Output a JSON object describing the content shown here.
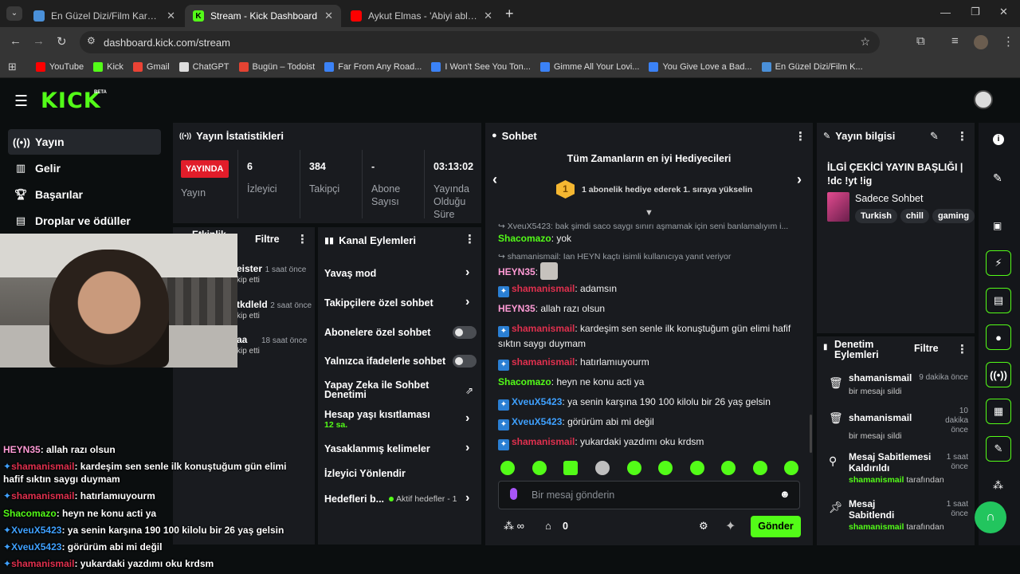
{
  "browser": {
    "tabs": [
      {
        "title": "En Güzel Dizi/Film Karakteri - T",
        "favicon_color": "#4a90d9"
      },
      {
        "title": "Stream - Kick Dashboard",
        "favicon_color": "#53fc18",
        "favicon_glyph": "K"
      },
      {
        "title": "Aykut Elmas - 'Abiyi ablayı' Lug",
        "favicon_color": "#ff0000"
      }
    ],
    "new_tab_label": "+",
    "url": "dashboard.kick.com/stream",
    "bookmarks": [
      {
        "label": "YouTube",
        "color": "#ff0000"
      },
      {
        "label": "Kick",
        "color": "#53fc18"
      },
      {
        "label": "Gmail",
        "color": "#ea4335"
      },
      {
        "label": "ChatGPT",
        "color": "#dddddd"
      },
      {
        "label": "Bugün – Todoist",
        "color": "#e44332"
      },
      {
        "label": "Far From Any Road...",
        "color": "#3b82f6"
      },
      {
        "label": "I Won't See You Ton...",
        "color": "#3b82f6"
      },
      {
        "label": "Gimme All Your Lovi...",
        "color": "#3b82f6"
      },
      {
        "label": "You Give Love a Bad...",
        "color": "#3b82f6"
      },
      {
        "label": "En Güzel Dizi/Film K...",
        "color": "#4a90d9"
      }
    ]
  },
  "kick": {
    "logo": "KICK",
    "logo_badge": "BETA",
    "sidebar": [
      {
        "label": "Yayın",
        "icon": "broadcast-icon"
      },
      {
        "label": "Gelir",
        "icon": "revenue-icon"
      },
      {
        "label": "Başarılar",
        "icon": "trophy-icon"
      },
      {
        "label": "Droplar ve ödüller",
        "icon": "gift-icon"
      }
    ],
    "stats": {
      "title": "Yayın İstatistikleri",
      "live_badge": "YAYINDA",
      "live_label": "Yayın",
      "viewers_value": "6",
      "viewers_label": "İzleyici",
      "followers_value": "384",
      "followers_label": "Takipçi",
      "subs_value": "-",
      "subs_label": "Abone Sayısı",
      "duration_value": "03:13:02",
      "duration_label": "Yayında Olduğu Süre"
    },
    "activity": {
      "title": "Etkinlik",
      "filter": "Filtre",
      "items": [
        {
          "name": "eister",
          "time": "1 saat önce",
          "sub": "kip etti"
        },
        {
          "name": "tkdleld",
          "time": "2 saat önce",
          "sub": "kip etti"
        },
        {
          "name": "aa",
          "time": "18 saat önce",
          "sub": "kip etti"
        }
      ]
    },
    "channel_actions": {
      "title": "Kanal Eylemleri",
      "slow_mode": "Yavaş mod",
      "followers_chat": "Takipçilere özel sohbet",
      "subs_chat": "Abonelere özel sohbet",
      "emote_chat": "Yalnızca ifadelerle sohbet",
      "ai_moderation": "Yapay Zeka ile Sohbet Denetimi",
      "account_age": "Hesap yaşı kısıtlaması",
      "account_age_value": "12 sa.",
      "banned_words": "Yasaklanmış kelimeler",
      "redirect": "İzleyici Yönlendir",
      "goals": "Hedefleri b...",
      "goals_status": "Aktif hedefler - 1"
    },
    "chat": {
      "title": "Sohbet",
      "top_gifters_title": "Tüm Zamanların en iyi Hediyecileri",
      "top_gifters_rank": "1",
      "top_gifters_sub": "1 abonelik hediye ederek 1. sıraya yükselin",
      "reply1": "XveuX5423: bak şimdi saco saygı sınırı aşmamak için seni banlamalıyım i...",
      "m1_user": "Shacomazo",
      "m1_text": "yok",
      "reply2": "shamanismail: Ian HEYN kaçtı isimli kullanıcıya yanıt veriyor",
      "m2_user": "HEYN35",
      "m3_user": "shamanismail",
      "m3_text": "adamsın",
      "m4_user": "HEYN35",
      "m4_text": "allah razı olsun",
      "m5_user": "shamanismail",
      "m5_text": "kardeşim sen senle ilk konuştuğum gün elimi hafif sıktın saygı duymam",
      "m6_user": "shamanismail",
      "m6_text": "hatırlamıuyourm",
      "m7_user": "Shacomazo",
      "m7_text": "heyn ne konu acti ya",
      "m8_user": "XveuX5423",
      "m8_text": "ya senin karşına 190 100 kilolu bir 26 yaş gelsin",
      "m9_user": "XveuX5423",
      "m9_text": "görürüm abi mi değil",
      "m10_user": "shamanismail",
      "m10_text": "yukardaki yazdımı oku krdsm",
      "input_placeholder": "Bir mesaj gönderin",
      "kicks_count": "0",
      "send_button": "Gönder",
      "accent": "#53fc18"
    },
    "stream_info": {
      "title": "Yayın bilgisi",
      "stream_title": "İLGİ ÇEKİCİ YAYIN BAŞLIĞI | !dc !yt !ig",
      "category": "Sadece Sohbet",
      "tags": [
        "Turkish",
        "chill",
        "gaming"
      ]
    },
    "moderation": {
      "title": "Denetim Eylemleri",
      "filter": "Filtre",
      "items": [
        {
          "name": "shamanismail",
          "sub": "bir mesajı sildi",
          "time": "9 dakika önce"
        },
        {
          "name": "shamanismail",
          "sub": "bir mesajı sildi",
          "time": "10 dakika önce"
        },
        {
          "name": "Mesaj Sabitlemesi Kaldırıldı",
          "sub_user": "shamanismail",
          "sub": "tarafından",
          "time": "1 saat önce"
        },
        {
          "name": "Mesaj Sabitlendi",
          "sub_user": "shamanismail",
          "sub": "tarafından",
          "time": "1 saat önce"
        }
      ]
    },
    "overlay_chat": [
      {
        "user": "HEYN35",
        "text": "allah razı olsun",
        "color": "#ff9bd6"
      },
      {
        "user": "shamanismail",
        "text": "kardeşim sen senle ilk konuştuğum gün elimi",
        "color": "#e0304e"
      },
      {
        "user": "",
        "text": "hafif sıktın saygı duymam",
        "color": "#ffffff"
      },
      {
        "user": "shamanismail",
        "text": "hatırlamıuyourm",
        "color": "#e0304e"
      },
      {
        "user": "Shacomazo",
        "text": "heyn ne konu acti ya",
        "color": "#53fc18"
      },
      {
        "user": "XveuX5423",
        "text": "ya senin karşına 190 100 kilolu bir 26 yaş gelsin",
        "color": "#3fa1ff"
      },
      {
        "user": "XveuX5423",
        "text": "görürüm abi mi değil",
        "color": "#3fa1ff"
      },
      {
        "user": "shamanismail",
        "text": "yukardaki yazdımı oku krdsm",
        "color": "#e0304e"
      }
    ]
  }
}
